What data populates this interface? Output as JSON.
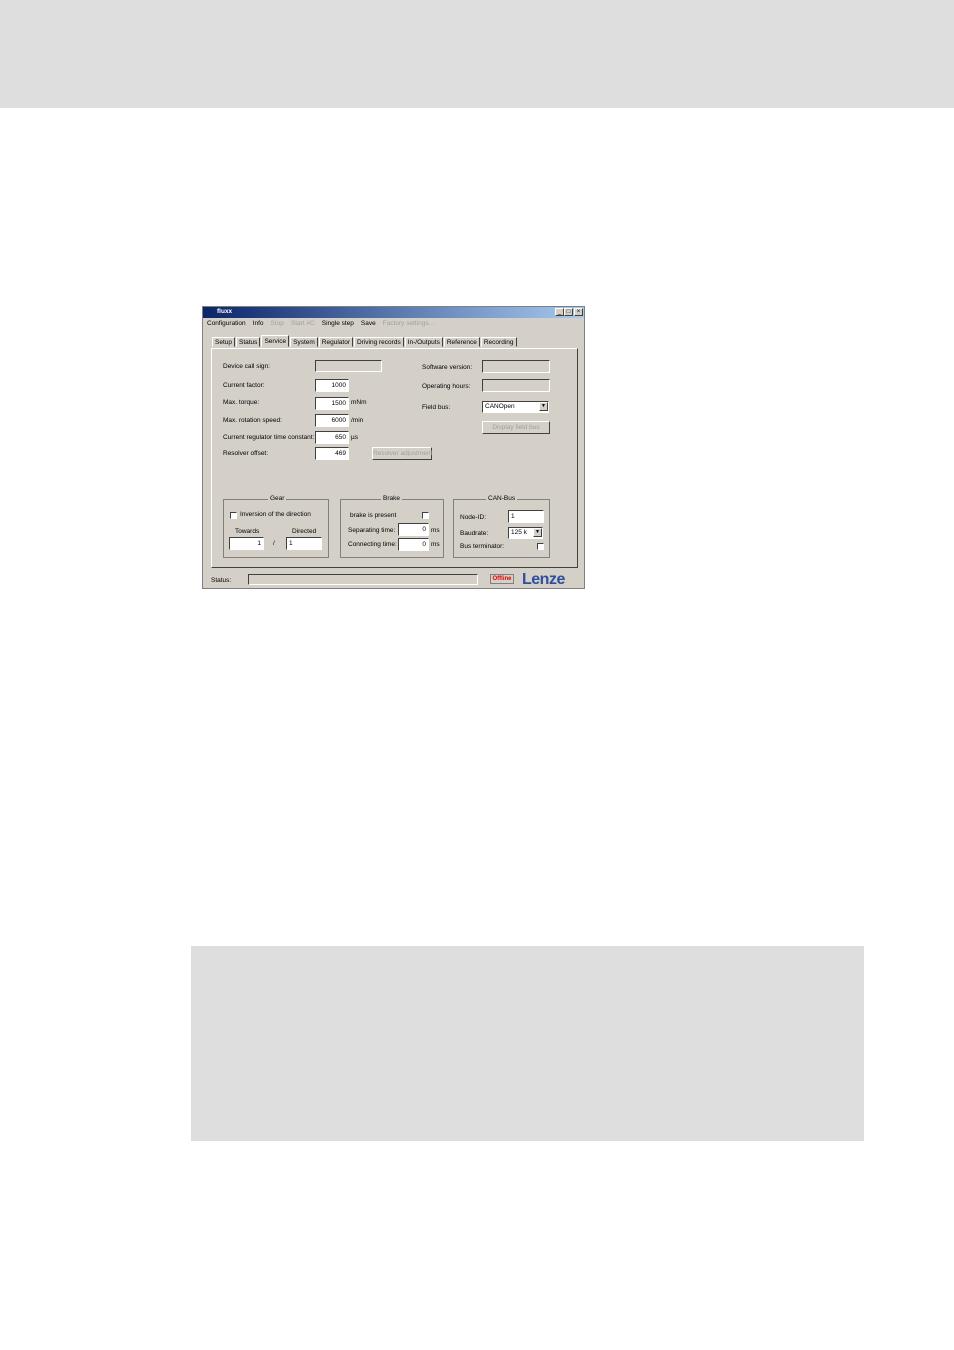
{
  "window": {
    "title": "fluxx",
    "minimize_label": "_",
    "maximize_label": "□",
    "close_label": "×"
  },
  "menu": {
    "items": [
      {
        "label": "Configuration",
        "enabled": true
      },
      {
        "label": "Info",
        "enabled": true
      },
      {
        "label": "Stop",
        "enabled": false
      },
      {
        "label": "Start #C",
        "enabled": false
      },
      {
        "label": "Single step",
        "enabled": true
      },
      {
        "label": "Save",
        "enabled": true
      },
      {
        "label": "Factory settings...",
        "enabled": false
      }
    ]
  },
  "tabs": [
    "Setup",
    "Status",
    "Service",
    "System",
    "Regulator",
    "Driving records",
    "In-/Outputs",
    "Reference",
    "Recording"
  ],
  "active_tab": "Service",
  "service": {
    "device_call_sign_label": "Device call sign:",
    "device_call_sign_value": "",
    "current_factor_label": "Current factor:",
    "current_factor_value": "1000",
    "max_torque_label": "Max. torque:",
    "max_torque_value": "1500",
    "max_torque_unit": "mNm",
    "max_rotation_speed_label": "Max. rotation speed:",
    "max_rotation_speed_value": "6000",
    "max_rotation_speed_unit": "/min",
    "current_regulator_label": "Current regulator time constant:",
    "current_regulator_value": "650",
    "current_regulator_unit": "µs",
    "resolver_offset_label": "Resolver offset:",
    "resolver_offset_value": "469",
    "resolver_adjustment_button": "Resolver adjustment",
    "software_version_label": "Software version:",
    "software_version_value": "",
    "operating_hours_label": "Operating hours:",
    "operating_hours_value": "",
    "field_bus_label": "Field bus:",
    "field_bus_value": "CANOpen",
    "display_field_bus_button": "Display field bus"
  },
  "gear": {
    "title": "Gear",
    "inversion_label": "Inversion of the direction",
    "inversion_checked": false,
    "towards_label": "Towards",
    "directed_label": "Directed",
    "towards_value": "1",
    "separator": "/",
    "directed_value": "1"
  },
  "brake": {
    "title": "Brake",
    "present_label": "brake is present",
    "present_checked": false,
    "separating_label": "Separating time:",
    "separating_value": "0",
    "separating_unit": "ms",
    "connecting_label": "Connecting time:",
    "connecting_value": "0",
    "connecting_unit": "ms"
  },
  "canbus": {
    "title": "CAN-Bus",
    "node_id_label": "Node-ID:",
    "node_id_value": "1",
    "baudrate_label": "Baudrate:",
    "baudrate_value": "125 k",
    "bus_terminator_label": "Bus terminator:",
    "bus_terminator_checked": false
  },
  "status": {
    "label": "Status:",
    "text": "",
    "connection": "Offline",
    "logo": "Lenze"
  },
  "colors": {
    "window_bg": "#d4d0c8",
    "titlebar": "#0a246a",
    "logo": "#2c4fa0",
    "offline": "#e00000",
    "page_band": "#dedede"
  }
}
